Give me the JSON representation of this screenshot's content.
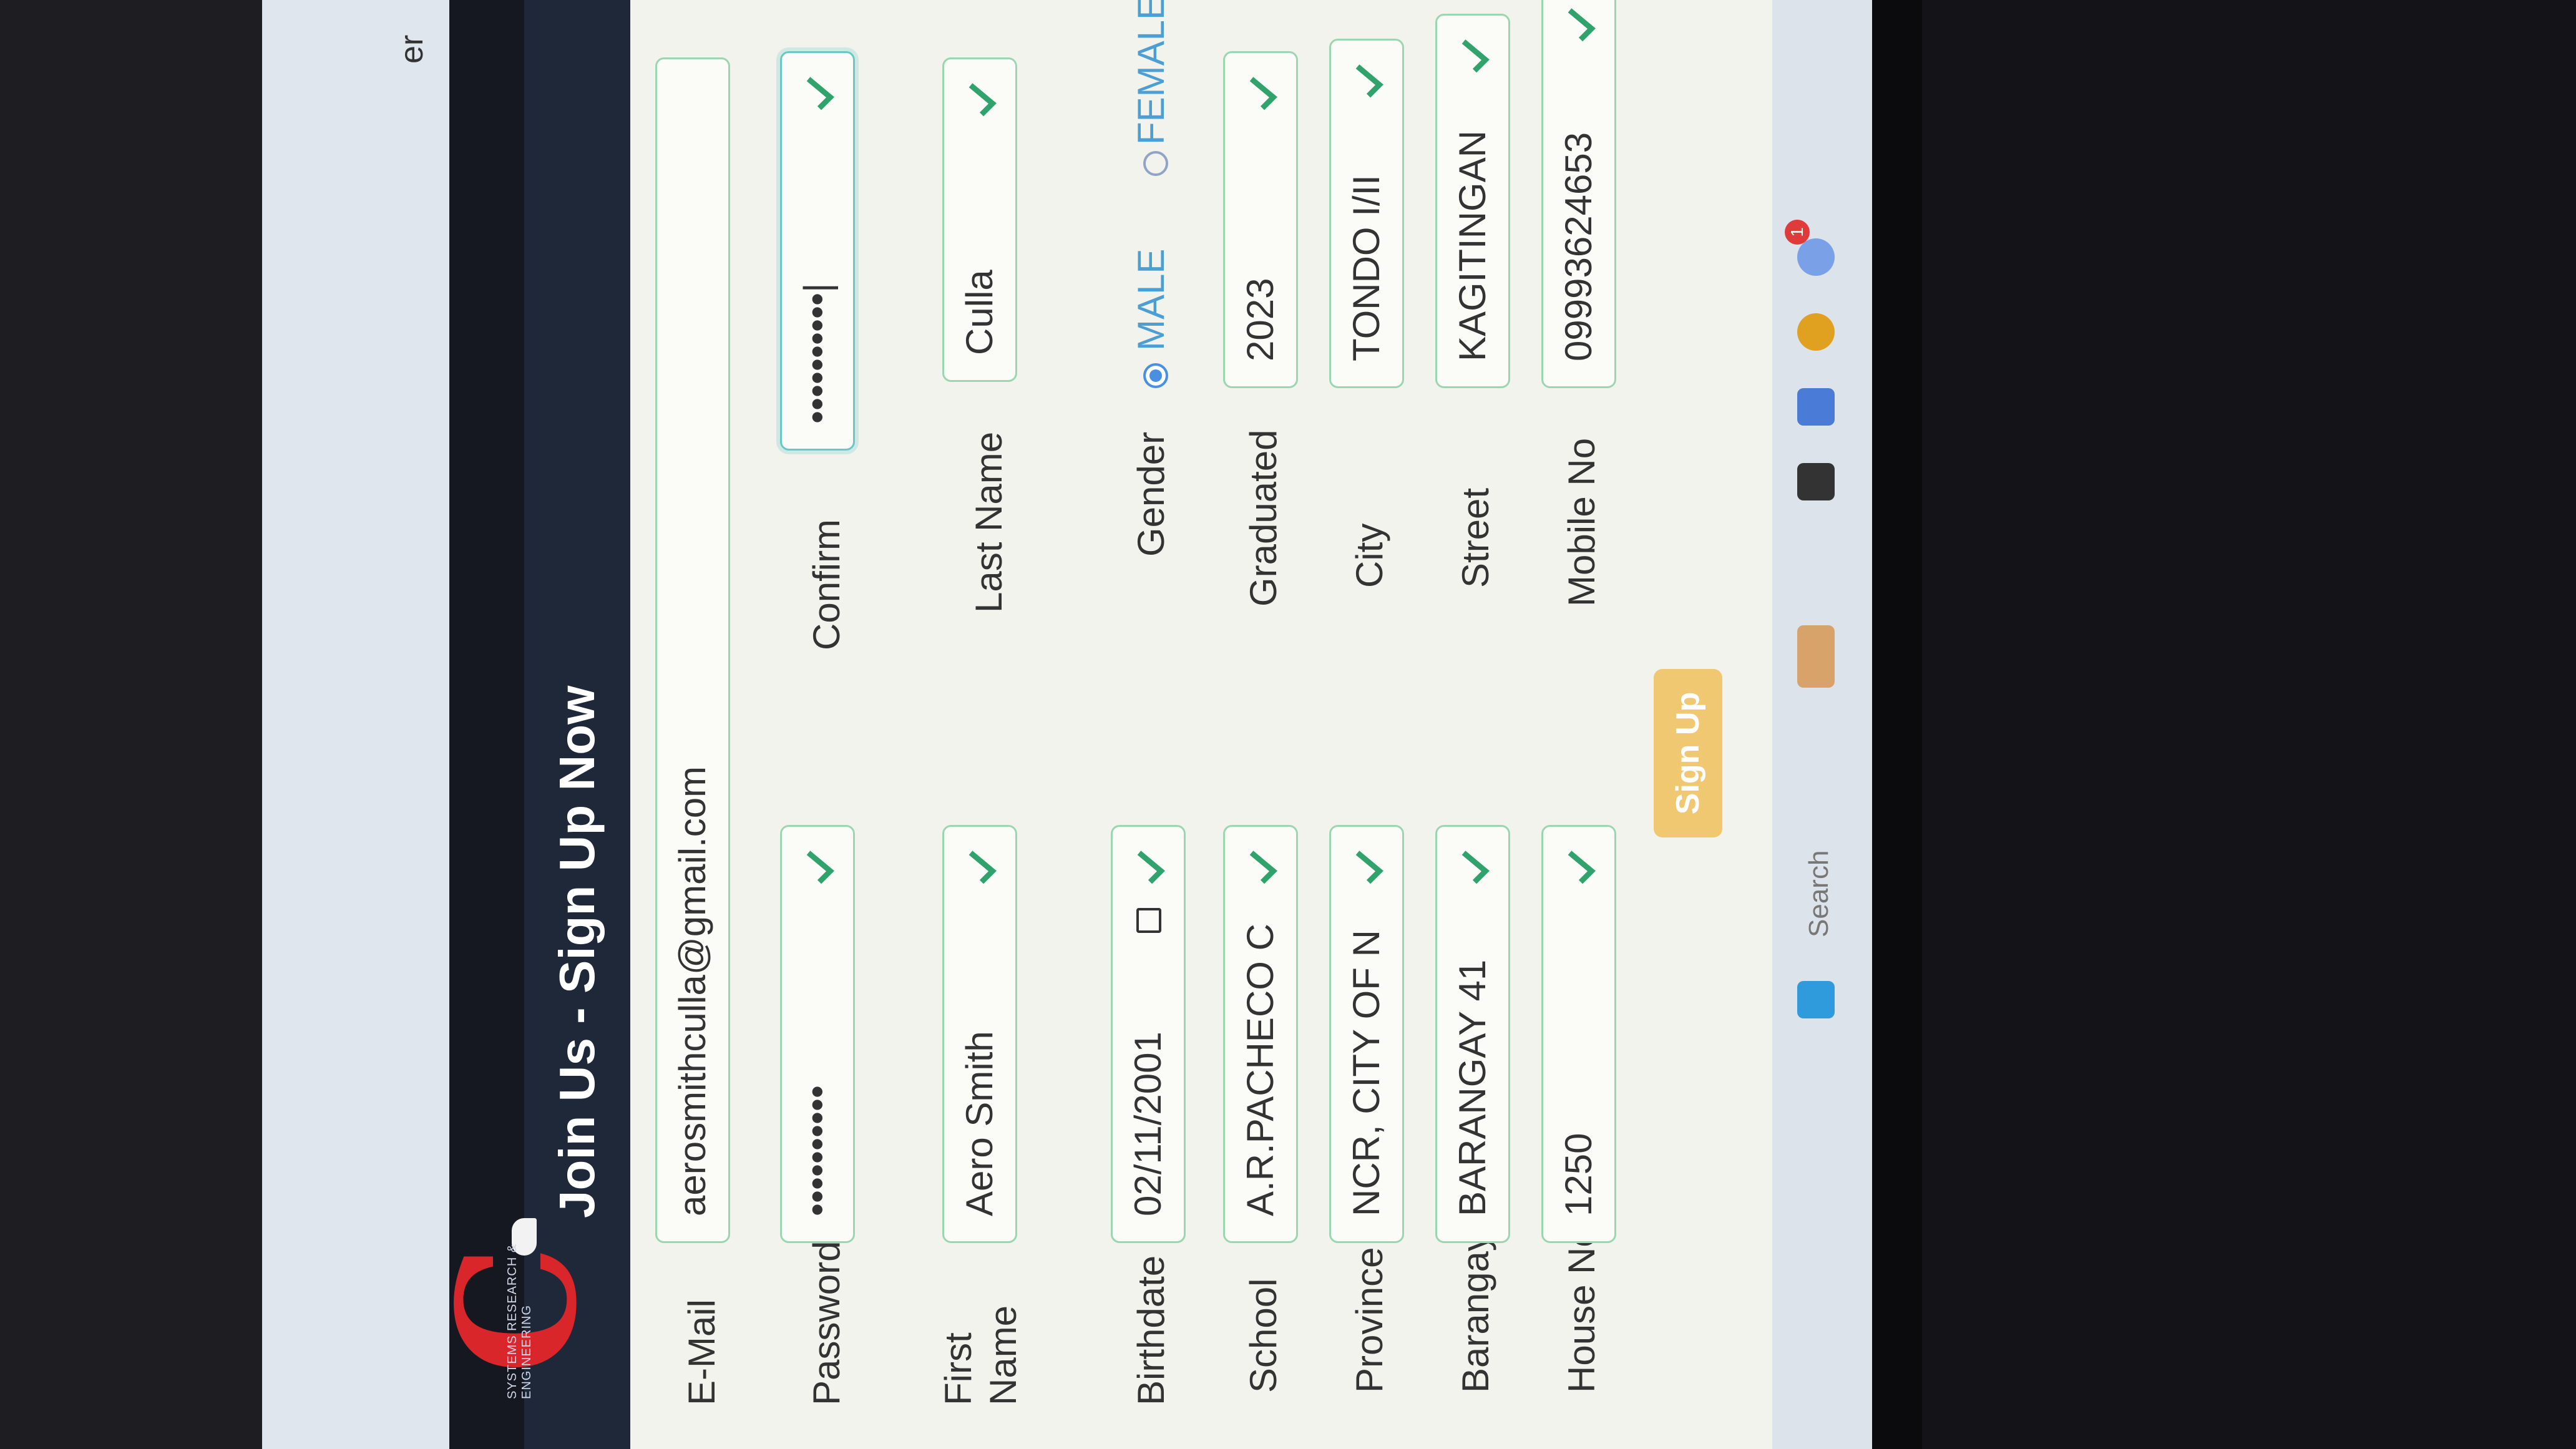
{
  "browser": {
    "tab_fragment": "er"
  },
  "header": {
    "title": "Join Us - Sign Up Now"
  },
  "logo": {
    "subtext": "SYSTEMS RESEARCH & ENGINEERING"
  },
  "form": {
    "email_label": "E-Mail",
    "email_value": "aerosmithculla@gmail.com",
    "password_label": "Password",
    "password_value": "••••••••••",
    "confirm_label": "Confirm",
    "confirm_value": "••••••••••|",
    "firstname_label": "First Name",
    "firstname_value": "Aero Smith",
    "lastname_label": "Last Name",
    "lastname_value": "Culla",
    "birthdate_label": "Birthdate",
    "birthdate_value": "02/11/2001",
    "gender_label": "Gender",
    "gender_male": "MALE",
    "gender_female": "FEMALE",
    "school_label": "School",
    "school_value": "A.R.PACHECO C",
    "graduated_label": "Graduated",
    "graduated_value": "2023",
    "province_label": "Province",
    "province_value": "NCR, CITY OF N",
    "city_label": "City",
    "city_value": "TONDO I/II",
    "barangay_label": "Barangay",
    "barangay_value": "BARANGAY 41",
    "street_label": "Street",
    "street_value": "KAGITINGAN",
    "houseno_label": "House No.",
    "houseno_value": "1250",
    "mobile_label": "Mobile No",
    "mobile_value": "09993624653",
    "signup_label": "Sign Up"
  },
  "taskbar": {
    "search_placeholder": "Search",
    "badge": "1"
  },
  "colors": {
    "valid_check": "#2fa36b",
    "accent": "#4a90e2",
    "header_bg": "#1e2838",
    "signup_bg": "#f1c872"
  }
}
